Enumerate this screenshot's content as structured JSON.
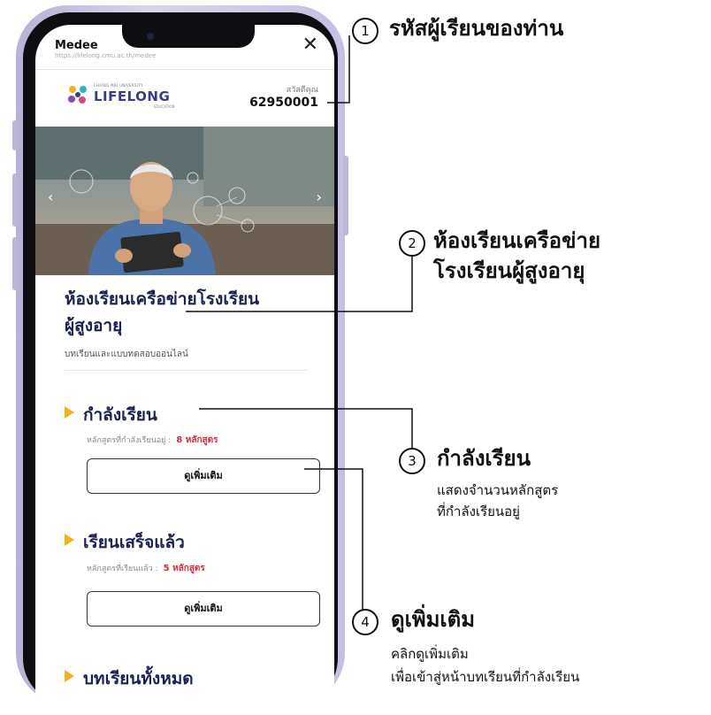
{
  "browser": {
    "title": "Medee",
    "url": "https://lifelong.cmu.ac.th/medee",
    "close_icon": "close-icon"
  },
  "header": {
    "logo_small": "CHIANG MAI UNIVERSITY",
    "logo_text": "LIFELONG",
    "logo_sub": "EDUCATION",
    "greeting": "สวัสดีคุณ",
    "student_id": "62950001"
  },
  "hero": {
    "prev_icon": "chevron-left-icon",
    "next_icon": "chevron-right-icon"
  },
  "main": {
    "title_line1": "ห้องเรียนเครือข่ายโรงเรียน",
    "title_line2": "ผู้สูงอายุ",
    "subtitle": "บทเรียนและแบบทดสอบออนไลน์",
    "sections": [
      {
        "heading": "กำลังเรียน",
        "sub_label": "หลักสูตรที่กำลังเรียนอยู่ :",
        "count": "8 หลักสูตร",
        "button": "ดูเพิ่มเติม"
      },
      {
        "heading": "เรียนเสร็จแล้ว",
        "sub_label": "หลักสูตรที่เรียนแล้ว :",
        "count": "5 หลักสูตร",
        "button": "ดูเพิ่มเติม"
      },
      {
        "heading": "บทเรียนทั้งหมด"
      }
    ]
  },
  "annotations": [
    {
      "num": "1",
      "heading": "รหัสผู้เรียนของท่าน"
    },
    {
      "num": "2",
      "heading_line1": "ห้องเรียนเครือข่าย",
      "heading_line2": "โรงเรียนผู้สูงอายุ"
    },
    {
      "num": "3",
      "heading": "กำลังเรียน",
      "body_line1": "แสดงจำนวนหลักสูตร",
      "body_line2": "ที่กำลังเรียนอยู่"
    },
    {
      "num": "4",
      "heading": "ดูเพิ่มเติม",
      "body_line1": "คลิกดูเพิ่มเติม",
      "body_line2": "เพื่อเข้าสู่หน้าบทเรียนที่กำลังเรียน"
    }
  ],
  "colors": {
    "accent_yellow": "#f2b21b",
    "count_red": "#d42a3c",
    "title_navy": "#1b2150",
    "frame_lilac": "#c7bfe2"
  }
}
